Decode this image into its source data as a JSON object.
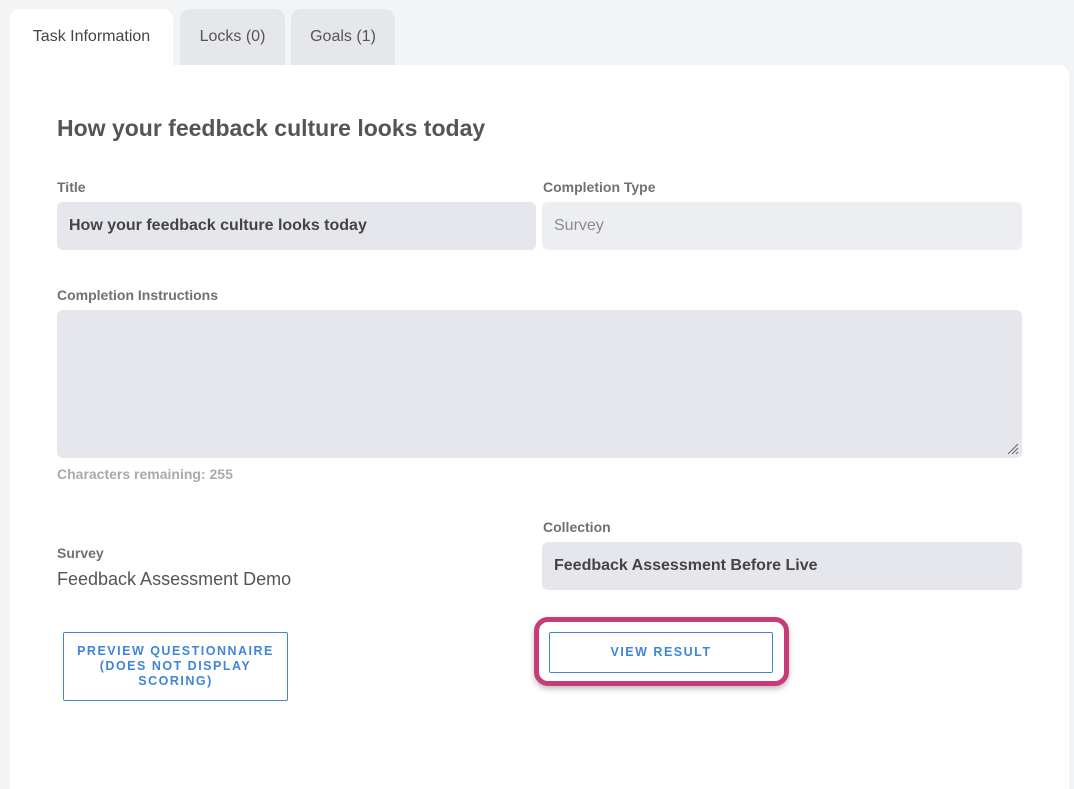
{
  "tabs": [
    {
      "label": "Task Information",
      "active": true
    },
    {
      "label": "Locks (0)",
      "active": false
    },
    {
      "label": "Goals (1)",
      "active": false
    }
  ],
  "page": {
    "heading": "How your feedback culture looks today"
  },
  "form": {
    "title_label": "Title",
    "title_value": "How your feedback culture looks today",
    "completion_type_label": "Completion Type",
    "completion_type_value": "Survey",
    "instructions_label": "Completion Instructions",
    "instructions_value": "",
    "chars_remaining": "Characters remaining: 255",
    "survey_label": "Survey",
    "survey_value": "Feedback Assessment Demo",
    "collection_label": "Collection",
    "collection_value": "Feedback Assessment Before Live"
  },
  "buttons": {
    "preview_label": "PREVIEW QUESTIONNAIRE (DOES NOT DISPLAY SCORING)",
    "view_result_label": "VIEW RESULT"
  },
  "colors": {
    "accent": "#3f86d8",
    "highlight": "#c83a78",
    "field_bg": "#e5e7ec"
  }
}
